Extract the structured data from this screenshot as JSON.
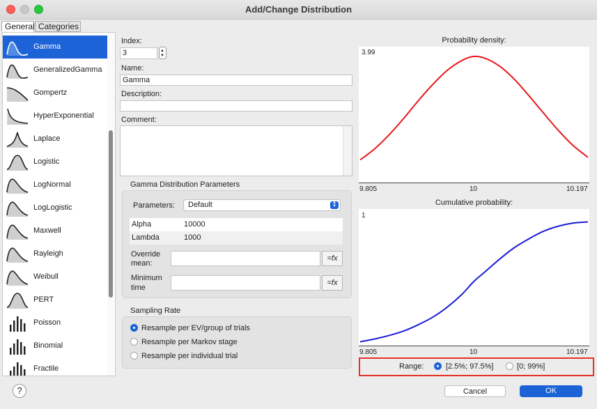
{
  "window": {
    "title": "Add/Change Distribution"
  },
  "tabs": {
    "general": "General",
    "categories": "Categories"
  },
  "distributions": [
    {
      "label": "Gamma",
      "icon": "gamma-curve-icon"
    },
    {
      "label": "GeneralizedGamma",
      "icon": "gamma-curve-icon"
    },
    {
      "label": "Gompertz",
      "icon": "gompertz-curve-icon"
    },
    {
      "label": "HyperExponential",
      "icon": "exponential-curve-icon"
    },
    {
      "label": "Laplace",
      "icon": "laplace-curve-icon"
    },
    {
      "label": "Logistic",
      "icon": "bell-curve-icon"
    },
    {
      "label": "LogNormal",
      "icon": "skewed-curve-icon"
    },
    {
      "label": "LogLogistic",
      "icon": "skewed-curve-icon"
    },
    {
      "label": "Maxwell",
      "icon": "skewed-curve-icon"
    },
    {
      "label": "Rayleigh",
      "icon": "skewed-curve-icon"
    },
    {
      "label": "Weibull",
      "icon": "skewed-curve-icon"
    },
    {
      "label": "PERT",
      "icon": "bell-curve-icon"
    },
    {
      "label": "Poisson",
      "icon": "bar-histogram-icon"
    },
    {
      "label": "Binomial",
      "icon": "bar-histogram-icon"
    },
    {
      "label": "Fractile",
      "icon": "bar-histogram-icon"
    }
  ],
  "form": {
    "index_label": "Index:",
    "index_value": "3",
    "name_label": "Name:",
    "name_value": "Gamma",
    "description_label": "Description:",
    "description_value": "",
    "comment_label": "Comment:",
    "comment_value": ""
  },
  "params_group": {
    "title": "Gamma Distribution Parameters",
    "parameters_label": "Parameters:",
    "parameters_value": "Default",
    "rows": [
      {
        "name": "Alpha",
        "value": "10000"
      },
      {
        "name": "Lambda",
        "value": "1000"
      }
    ],
    "override_mean_label_1": "Override",
    "override_mean_label_2": "mean:",
    "minimum_time_label_1": "Minimum",
    "minimum_time_label_2": "time",
    "fx_label": "=fx"
  },
  "sampling": {
    "title": "Sampling Rate",
    "options": [
      {
        "label": "Resample per EV/group of trials",
        "selected": true
      },
      {
        "label": "Resample per Markov stage",
        "selected": false
      },
      {
        "label": "Resample per individual trial",
        "selected": false
      }
    ]
  },
  "chart_data": [
    {
      "type": "line",
      "title": "Probability density:",
      "color": "#e8161b",
      "x": [
        9.805,
        9.83,
        9.855,
        9.88,
        9.905,
        9.93,
        9.955,
        9.98,
        10.0,
        10.02,
        10.045,
        10.07,
        10.095,
        10.12,
        10.145,
        10.17,
        10.197
      ],
      "y": [
        0.7,
        1.05,
        1.5,
        2.02,
        2.58,
        3.1,
        3.55,
        3.86,
        3.99,
        3.93,
        3.68,
        3.27,
        2.75,
        2.2,
        1.66,
        1.18,
        0.78
      ],
      "ylim": [
        0,
        3.99
      ],
      "xlim": [
        9.805,
        10.197
      ],
      "ytick_top": "3.99",
      "xticks": [
        "9.805",
        "10",
        "10.197"
      ]
    },
    {
      "type": "line",
      "title": "Cumulative probability:",
      "color": "#1c1cd6",
      "x": [
        9.805,
        9.83,
        9.855,
        9.88,
        9.905,
        9.93,
        9.955,
        9.98,
        10.0,
        10.02,
        10.045,
        10.07,
        10.095,
        10.12,
        10.145,
        10.17,
        10.197
      ],
      "y": [
        0.025,
        0.047,
        0.075,
        0.11,
        0.16,
        0.22,
        0.3,
        0.4,
        0.5,
        0.58,
        0.68,
        0.77,
        0.84,
        0.9,
        0.94,
        0.965,
        0.975
      ],
      "ylim": [
        0,
        1
      ],
      "xlim": [
        9.805,
        10.197
      ],
      "ytick_top": "1",
      "xticks": [
        "9.805",
        "10",
        "10.197"
      ]
    }
  ],
  "range": {
    "label": "Range:",
    "options": [
      {
        "label": "[2.5%; 97.5%]",
        "selected": true
      },
      {
        "label": "[0; 99%]",
        "selected": false
      }
    ]
  },
  "buttons": {
    "help": "?",
    "cancel": "Cancel",
    "ok": "OK"
  },
  "colors": {
    "accent": "#1d63d8",
    "highlight_border": "#e53226"
  }
}
